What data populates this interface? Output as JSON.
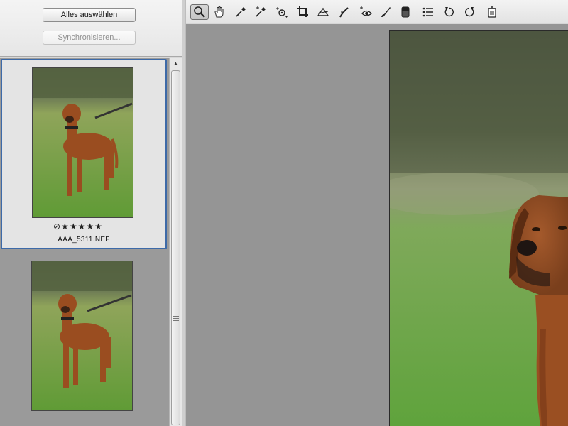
{
  "left_panel": {
    "select_all_label": "Alles auswählen",
    "synchronize_label": "Synchronisieren..."
  },
  "filmstrip": {
    "items": [
      {
        "rating_text": "⊘★★★★★",
        "filename": "AAA_5311.NEF",
        "selected": true
      },
      {
        "rating_text": "",
        "filename": "",
        "selected": false
      }
    ]
  },
  "toolbar": {
    "tools": [
      {
        "name": "zoom-tool",
        "icon": "magnifier-icon",
        "active": true
      },
      {
        "name": "hand-tool",
        "icon": "hand-icon"
      },
      {
        "name": "white-balance-tool",
        "icon": "eyedropper-icon"
      },
      {
        "name": "color-sampler-tool",
        "icon": "color-sampler-icon"
      },
      {
        "name": "target-adjustment-tool",
        "icon": "target-icon"
      },
      {
        "name": "crop-tool",
        "icon": "crop-icon"
      },
      {
        "name": "straighten-tool",
        "icon": "straighten-icon"
      },
      {
        "name": "spot-removal-tool",
        "icon": "spot-removal-icon"
      },
      {
        "name": "red-eye-tool",
        "icon": "red-eye-icon"
      },
      {
        "name": "adjustment-brush-tool",
        "icon": "brush-icon"
      },
      {
        "name": "graduated-filter-tool",
        "icon": "gradient-icon"
      },
      {
        "name": "preferences-tool",
        "icon": "list-icon"
      },
      {
        "name": "rotate-left-tool",
        "icon": "rotate-ccw-icon"
      },
      {
        "name": "rotate-right-tool",
        "icon": "rotate-cw-icon"
      },
      {
        "name": "delete-tool",
        "icon": "trash-icon"
      }
    ]
  },
  "colors": {
    "selection_border": "#3d6aa8",
    "canvas_gray": "#959595",
    "filmstrip_gray": "#9a9a9a"
  }
}
